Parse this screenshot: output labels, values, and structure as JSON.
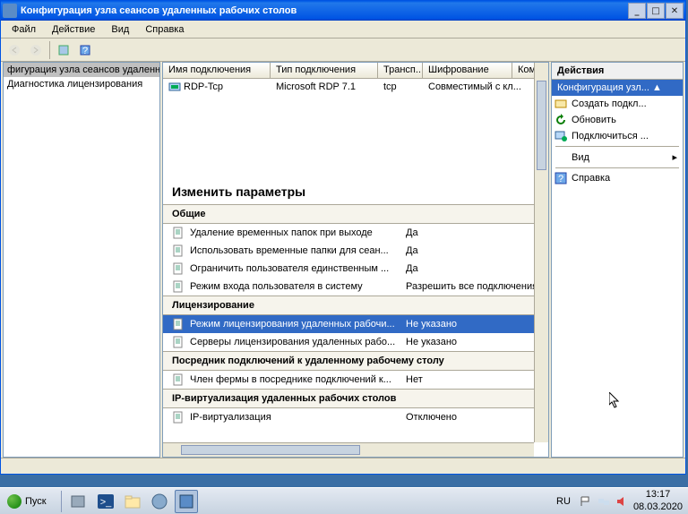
{
  "window": {
    "title": "Конфигурация узла сеансов удаленных рабочих столов"
  },
  "menu": {
    "file": "Файл",
    "action": "Действие",
    "view": "Вид",
    "help": "Справка"
  },
  "tree": {
    "items": [
      "фигурация узла сеансов удаленны",
      "Диагностика лицензирования"
    ]
  },
  "columns": {
    "c0": "Имя подключения",
    "c1": "Тип подключения",
    "c2": "Трансп...",
    "c3": "Шифрование",
    "c4": "Ком"
  },
  "connection": {
    "name": "RDP-Tcp",
    "type": "Microsoft RDP 7.1",
    "transport": "tcp",
    "encryption": "Совместимый с кл..."
  },
  "settings": {
    "title": "Изменить параметры",
    "general": {
      "header": "Общие",
      "r0": {
        "label": "Удаление временных папок при выходе",
        "val": "Да"
      },
      "r1": {
        "label": "Использовать временные папки для сеан...",
        "val": "Да"
      },
      "r2": {
        "label": "Ограничить пользователя единственным ...",
        "val": "Да"
      },
      "r3": {
        "label": "Режим входа пользователя в систему",
        "val": "Разрешить все подключения"
      }
    },
    "licensing": {
      "header": "Лицензирование",
      "r0": {
        "label": "Режим лицензирования удаленных рабочи...",
        "val": "Не указано"
      },
      "r1": {
        "label": "Серверы лицензирования удаленных рабо...",
        "val": "Не указано"
      }
    },
    "broker": {
      "header": "Посредник подключений к удаленному рабочему столу",
      "r0": {
        "label": "Член фермы в посреднике подключений к...",
        "val": "Нет"
      }
    },
    "ipvirt": {
      "header": "IP-виртуализация удаленных рабочих столов",
      "r0": {
        "label": "IP-виртуализация",
        "val": "Отключено"
      }
    }
  },
  "actions": {
    "title": "Действия",
    "subtitle": "Конфигурация узл... ▲",
    "items": {
      "create": "Создать подкл...",
      "refresh": "Обновить",
      "connect": "Подключиться ...",
      "view": "Вид",
      "help": "Справка"
    }
  },
  "taskbar": {
    "start": "Пуск",
    "lang": "RU",
    "time": "13:17",
    "date": "08.03.2020"
  }
}
